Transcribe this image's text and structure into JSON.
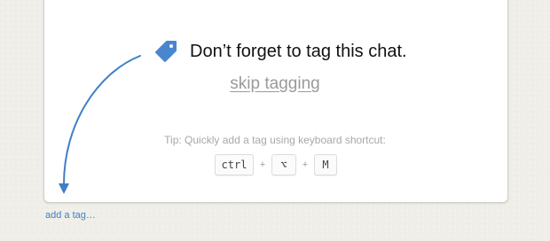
{
  "prompt": {
    "headline": "Don’t forget to tag this chat.",
    "skip_label": "skip tagging",
    "tip": "Tip: Quickly add a tag using keyboard shortcut:",
    "shortcut_keys": [
      "ctrl",
      "⌥",
      "M"
    ],
    "plus_symbol": "+"
  },
  "footer": {
    "add_tag_label": "add a tag…"
  },
  "icons": {
    "tag": "tag-icon",
    "arrow": "curved-arrow-icon"
  },
  "colors": {
    "accent": "#3f7fc7",
    "tag_icon": "#4a86cf",
    "muted_text": "#9a9a9a",
    "background": "#efeee8"
  }
}
